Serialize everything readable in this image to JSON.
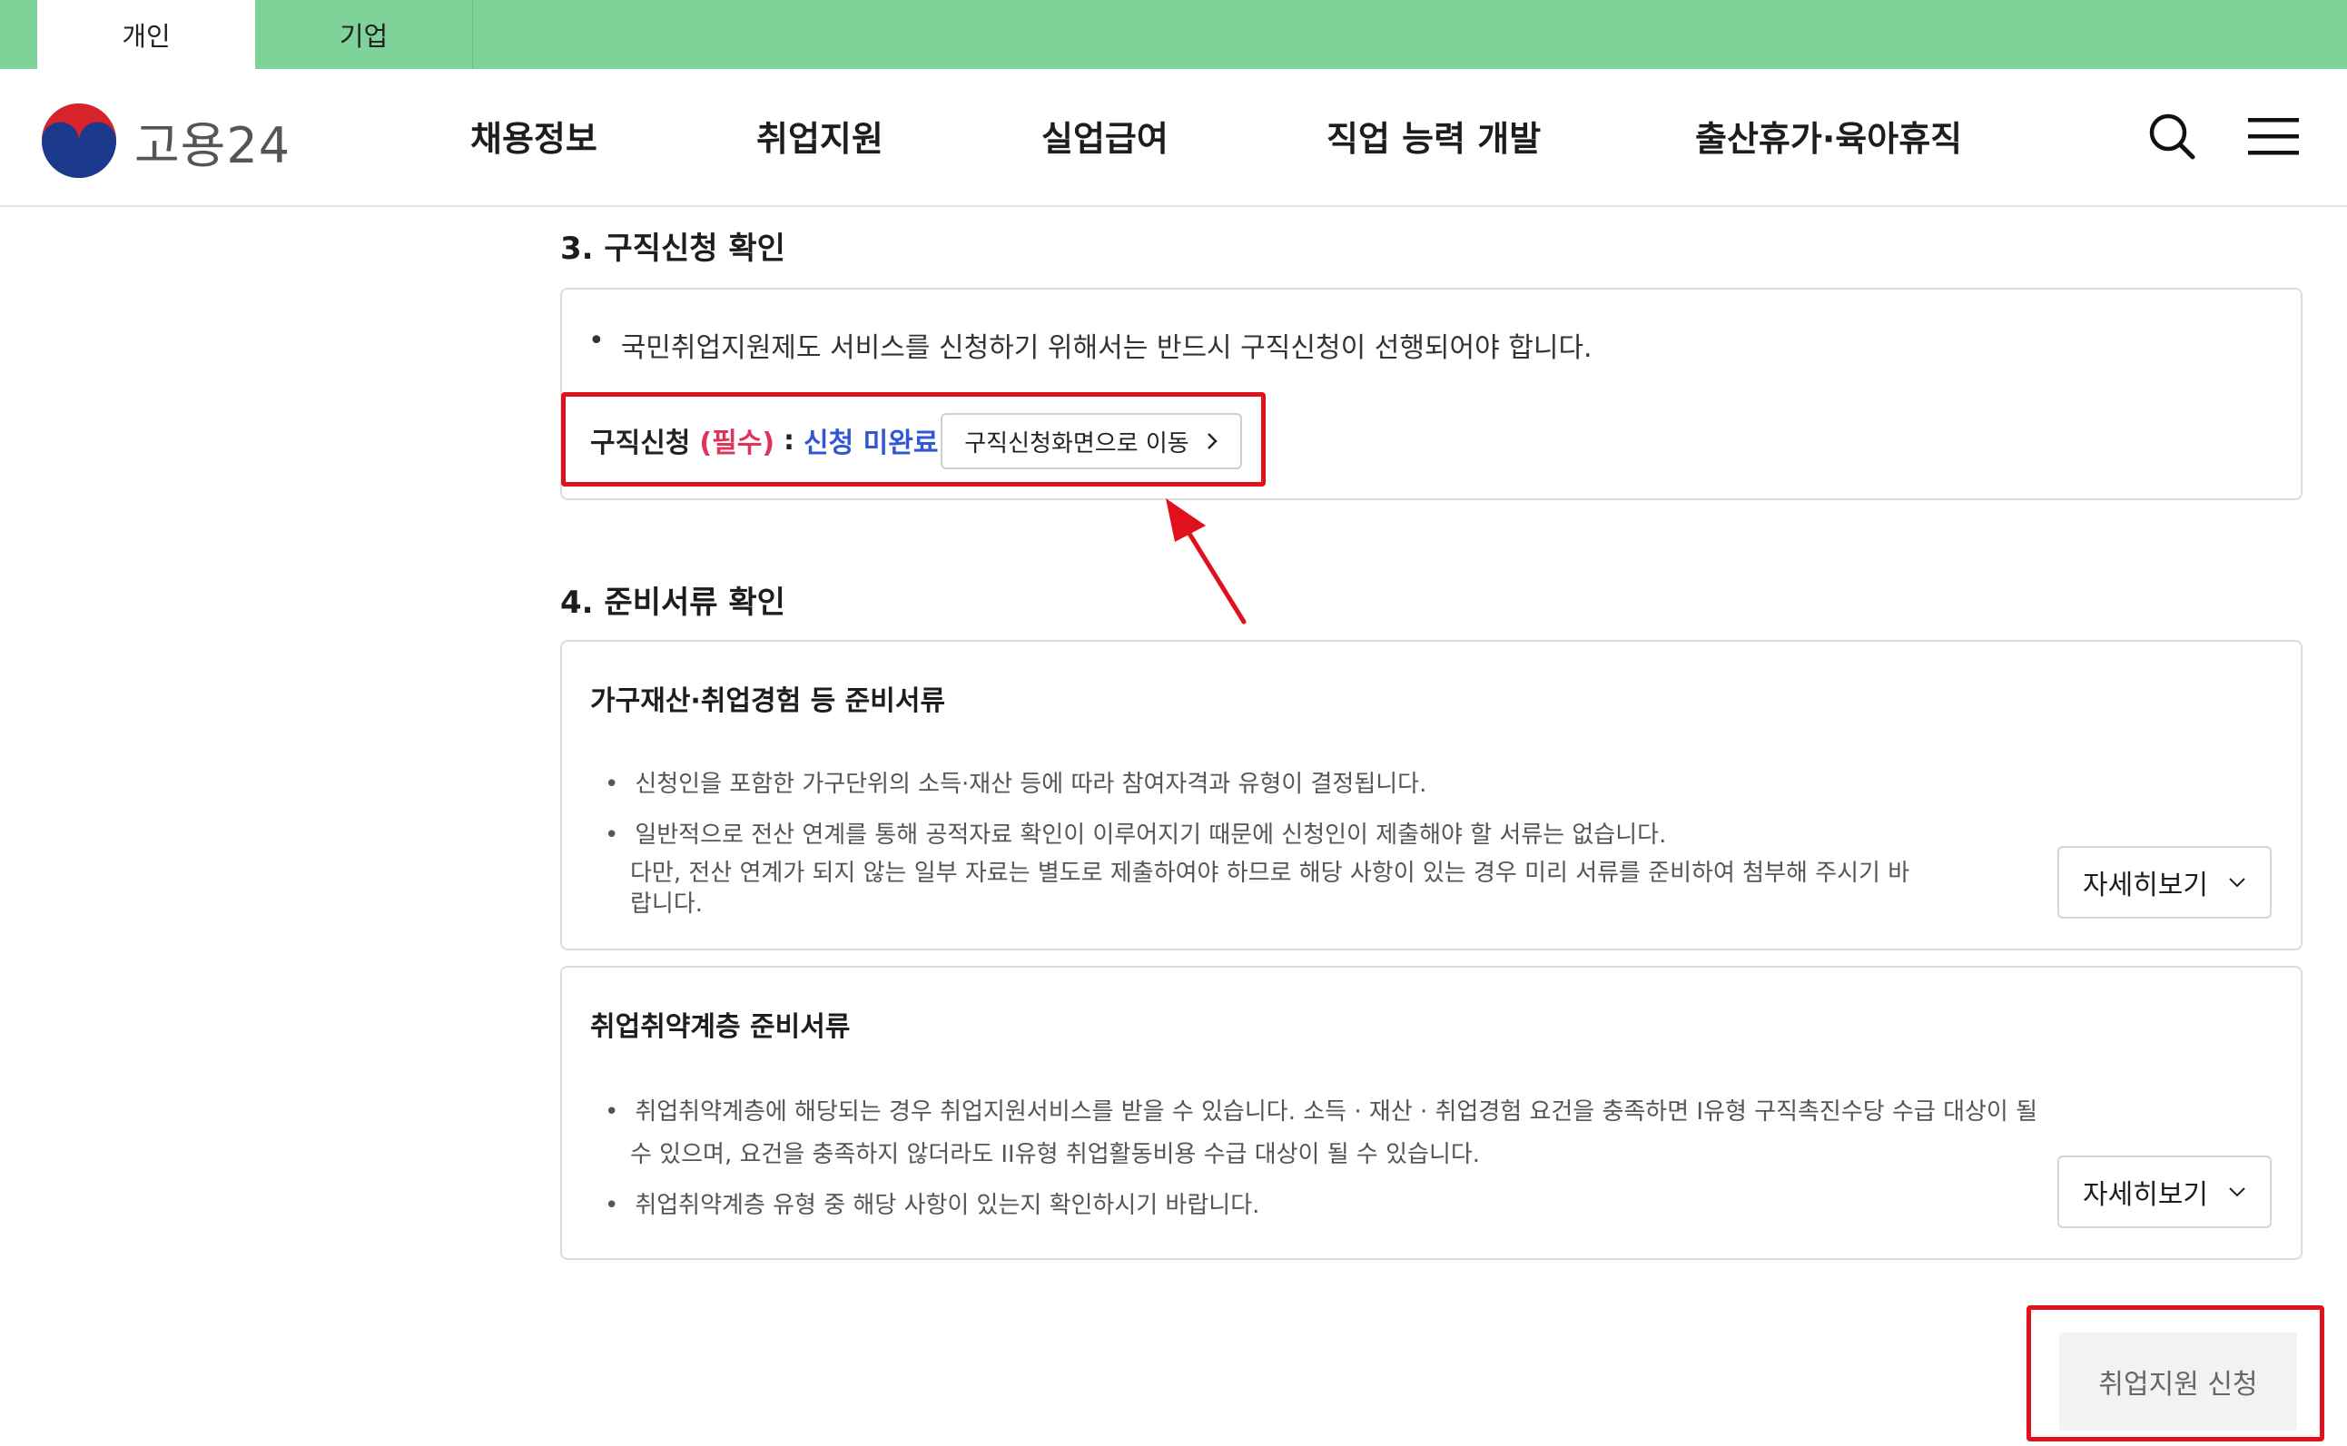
{
  "topbar": {
    "tabs": [
      {
        "label": "개인",
        "active": true
      },
      {
        "label": "기업",
        "active": false
      }
    ]
  },
  "header": {
    "logo_text": "고용24",
    "nav": [
      "채용정보",
      "취업지원",
      "실업급여",
      "직업 능력 개발",
      "출산휴가·육아휴직"
    ],
    "icons": [
      "search-icon",
      "menu-icon"
    ]
  },
  "section3": {
    "title": "3. 구직신청 확인",
    "notice": "국민취업지원제도 서비스를 신청하기 위해서는 반드시 구직신청이 선행되어야 합니다.",
    "req_label": "구직신청",
    "req_must": "(필수)",
    "req_colon": ":",
    "req_status": "신청 미완료",
    "move_button": "구직신청화면으로 이동"
  },
  "section4": {
    "title": "4. 준비서류 확인",
    "box1": {
      "heading": "가구재산·취업경험 등 준비서류",
      "bullets": [
        "신청인을 포함한 가구단위의 소득·재산 등에 따라 참여자격과 유형이 결정됩니다.",
        "일반적으로 전산 연계를 통해 공적자료 확인이 이루어지기 때문에 신청인이 제출해야 할 서류는 없습니다."
      ],
      "bullet2_line2": "다만, 전산 연계가 되지 않는 일부 자료는 별도로 제출하여야 하므로 해당 사항이 있는 경우 미리 서류를 준비하여 첨부해 주시기 바",
      "bullet2_line3": "랍니다.",
      "detail_button": "자세히보기"
    },
    "box2": {
      "heading": "취업취약계층 준비서류",
      "bullet1_line1": "취업취약계층에 해당되는 경우 취업지원서비스를 받을 수 있습니다. 소득 · 재산 · 취업경험 요건을 충족하면 I유형 구직촉진수당 수급 대상이 될",
      "bullet1_line2": "수 있으며, 요건을 충족하지 않더라도 II유형 취업활동비용 수급 대상이 될 수 있습니다.",
      "bullet2": "취업취약계층 유형 중 해당 사항이 있는지 확인하시기 바랍니다.",
      "detail_button": "자세히보기"
    }
  },
  "footer": {
    "apply_button": "취업지원 신청"
  },
  "colors": {
    "topbar": "#80d398",
    "highlight": "#e0101c",
    "must": "#e0335a",
    "status": "#3058d6"
  }
}
